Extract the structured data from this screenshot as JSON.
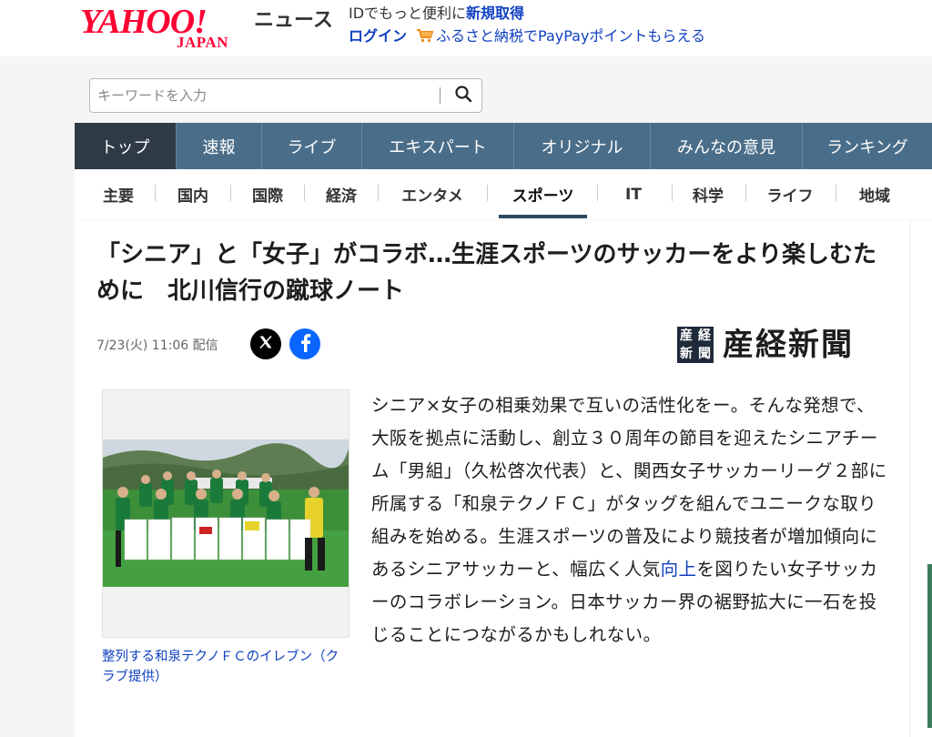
{
  "header": {
    "logo_main": "YAHOO!",
    "logo_sub": "JAPAN",
    "service_name": "ニュース",
    "promo_text": "IDでもっと便利に",
    "signup_link": "新規取得",
    "login_link": "ログイン",
    "furusato_link": "ふるさと納税でPayPayポイントもらえる"
  },
  "search": {
    "placeholder": "キーワードを入力"
  },
  "nav_primary": [
    {
      "label": "トップ"
    },
    {
      "label": "速報"
    },
    {
      "label": "ライブ"
    },
    {
      "label": "エキスパート"
    },
    {
      "label": "オリジナル"
    },
    {
      "label": "みんなの意見"
    },
    {
      "label": "ランキング"
    }
  ],
  "nav_primary_active": "トップ",
  "nav_secondary": [
    {
      "label": "主要"
    },
    {
      "label": "国内"
    },
    {
      "label": "国際"
    },
    {
      "label": "経済"
    },
    {
      "label": "エンタメ"
    },
    {
      "label": "スポーツ"
    },
    {
      "label": "IT"
    },
    {
      "label": "科学"
    },
    {
      "label": "ライフ"
    },
    {
      "label": "地域"
    }
  ],
  "nav_secondary_active": "スポーツ",
  "article": {
    "title": "「シニア」と「女子」がコラボ…生涯スポーツのサッカーをより楽しむために　北川信行の蹴球ノート",
    "date": "7/23(火) 11:06 配信",
    "source_name": "産経新聞",
    "source_seal": [
      "産",
      "経",
      "新",
      "聞"
    ],
    "photo_caption": "整列する和泉テクノＦＣのイレブン（クラブ提供）",
    "body_before_link": "シニア×女子の相乗効果で互いの活性化をー。そんな発想で、大阪を拠点に活動し、創立３０周年の節目を迎えたシニアチーム「男組」（久松啓次代表）と、関西女子サッカーリーグ２部に所属する「和泉テクノＦＣ」がタッグを組んでユニークな取り組みを始める。生涯スポーツの普及により競技者が増加傾向にあるシニアサッカーと、幅広く人気",
    "body_link": "向上",
    "body_after_link": "を図りたい女子サッカーのコラボレーション。日本サッカー界の裾野拡大に一石を投じることにつながるかもしれない。"
  },
  "colors": {
    "brand_red": "#ff0033",
    "link_blue": "#1040c0",
    "nav_bg": "#4a6e8a",
    "nav_active": "#2e3a46",
    "facebook": "#0866ff"
  },
  "icons": {
    "search": "search-icon",
    "cart": "cart-icon",
    "x": "x-logo-icon",
    "facebook": "facebook-icon"
  }
}
